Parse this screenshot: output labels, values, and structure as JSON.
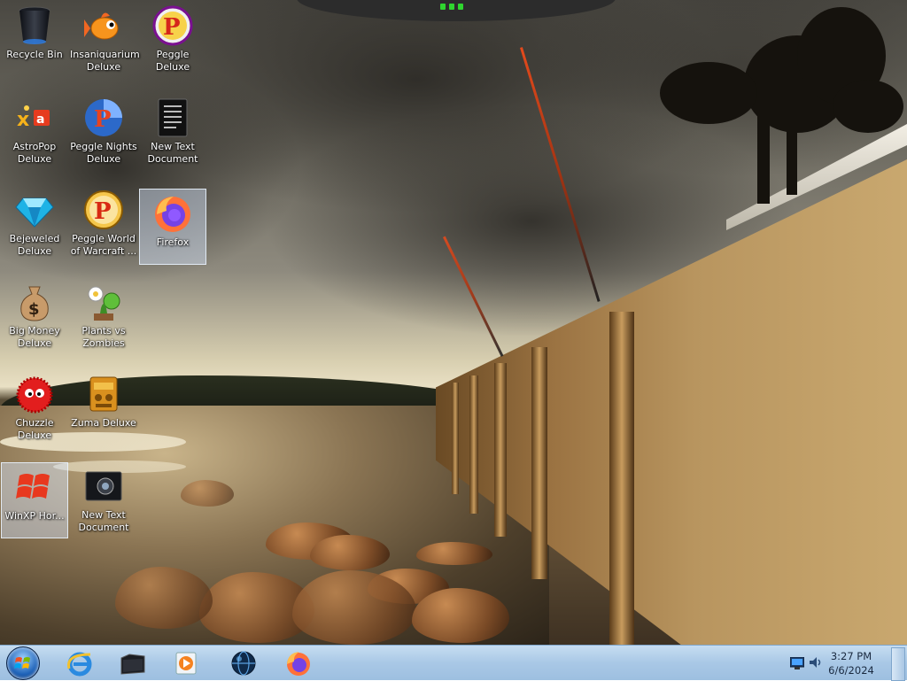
{
  "desktop": {
    "icons": [
      {
        "label": "Recycle Bin",
        "icon": "recycle-bin-icon",
        "selected": false
      },
      {
        "label": "Insaniquarium Deluxe",
        "icon": "goldfish-icon",
        "selected": false
      },
      {
        "label": "Peggle Deluxe",
        "icon": "peggle-icon",
        "selected": false
      },
      {
        "label": "AstroPop Deluxe",
        "icon": "astropop-icon",
        "selected": false
      },
      {
        "label": "Peggle Nights Deluxe",
        "icon": "peggle-nights-icon",
        "selected": false
      },
      {
        "label": "New Text Document",
        "icon": "text-document-icon",
        "selected": false
      },
      {
        "label": "Bejeweled Deluxe",
        "icon": "gem-icon",
        "selected": false
      },
      {
        "label": "Peggle World of Warcraft ...",
        "icon": "peggle-wow-icon",
        "selected": false
      },
      {
        "label": "Firefox",
        "icon": "firefox-icon",
        "selected": true
      },
      {
        "label": "Big Money Deluxe",
        "icon": "money-bag-icon",
        "selected": false
      },
      {
        "label": "Plants vs Zombies",
        "icon": "plant-icon",
        "selected": false
      },
      {
        "label": "Chuzzle Deluxe",
        "icon": "chuzzle-icon",
        "selected": false
      },
      {
        "label": "Zuma Deluxe",
        "icon": "zuma-icon",
        "selected": false
      },
      {
        "label": "WinXP Hor...",
        "icon": "windows-xp-icon",
        "selected": true
      },
      {
        "label": "New Text Document",
        "icon": "camera-document-icon",
        "selected": false
      }
    ]
  },
  "taskbar": {
    "start_icon": "windows-orb-icon",
    "pinned": [
      {
        "name": "internet-explorer",
        "icon": "internet-explorer-icon"
      },
      {
        "name": "file-explorer",
        "icon": "folder-icon"
      },
      {
        "name": "media-player",
        "icon": "media-player-icon"
      },
      {
        "name": "globe-browser",
        "icon": "globe-icon"
      },
      {
        "name": "firefox",
        "icon": "firefox-icon"
      }
    ],
    "tray": {
      "icons": [
        "network-icon",
        "volume-icon"
      ],
      "time": "3:27 PM",
      "date": "6/6/2024"
    }
  },
  "colors": {
    "taskbar": "#a9c8e6",
    "selection": "#d7e6ff",
    "label_text": "#ffffff"
  }
}
